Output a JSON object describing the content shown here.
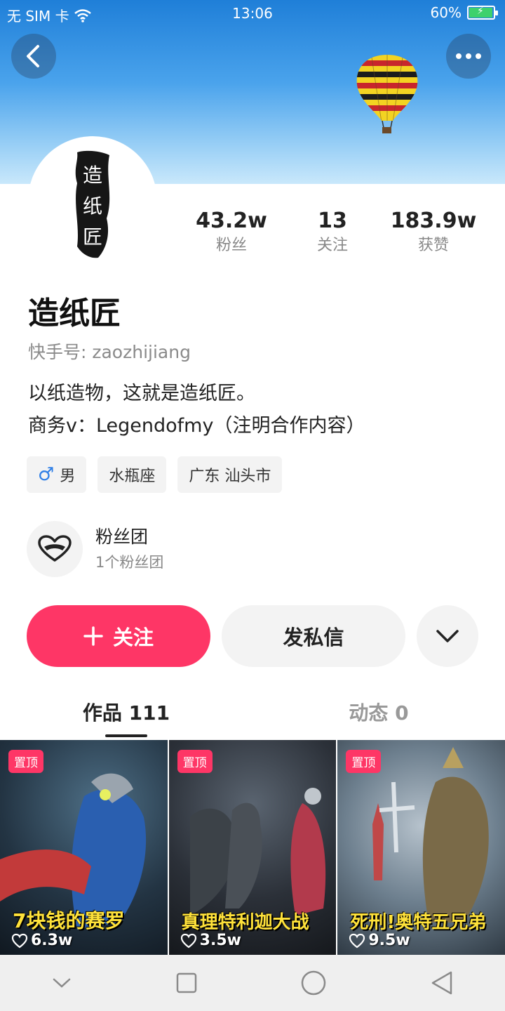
{
  "status_bar": {
    "carrier": "无 SIM 卡",
    "time": "13:06",
    "battery": "60%"
  },
  "profile": {
    "name": "造纸匠",
    "user_id": "快手号: zaozhijiang",
    "bio_line1": "以纸造物，这就是造纸匠。",
    "bio_line2": "商务v：Legendofmy（注明合作内容）",
    "avatar_text": "造纸匠"
  },
  "stats": [
    {
      "value": "43.2w",
      "label": "粉丝"
    },
    {
      "value": "13",
      "label": "关注"
    },
    {
      "value": "183.9w",
      "label": "获赞"
    }
  ],
  "tags": {
    "gender": "男",
    "zodiac": "水瓶座",
    "location": "广东 汕头市"
  },
  "fan_club": {
    "title": "粉丝团",
    "subtitle": "1个粉丝团"
  },
  "actions": {
    "follow": "关注",
    "message": "发私信"
  },
  "tabs": {
    "works": "作品 111",
    "feed": "动态 0"
  },
  "videos": [
    {
      "pinned": "置顶",
      "caption": "7块钱的赛罗",
      "likes": "6.3w"
    },
    {
      "pinned": "置顶",
      "caption": "真理特利迦大战",
      "likes": "3.5w"
    },
    {
      "pinned": "置顶",
      "caption": "死刑!奥特五兄弟",
      "likes": "9.5w"
    }
  ],
  "colors": {
    "accent": "#fe3666",
    "male": "#2f7fe6"
  }
}
